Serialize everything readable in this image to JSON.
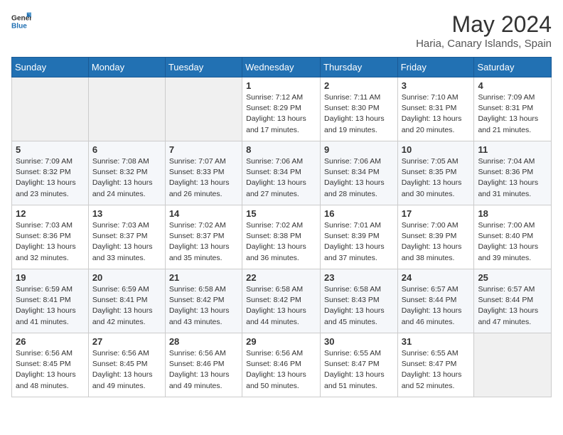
{
  "logo": {
    "text_general": "General",
    "text_blue": "Blue"
  },
  "header": {
    "title": "May 2024",
    "subtitle": "Haria, Canary Islands, Spain"
  },
  "weekdays": [
    "Sunday",
    "Monday",
    "Tuesday",
    "Wednesday",
    "Thursday",
    "Friday",
    "Saturday"
  ],
  "weeks": [
    [
      null,
      null,
      null,
      {
        "day": 1,
        "sunrise": "7:12 AM",
        "sunset": "8:29 PM",
        "daylight": "13 hours and 17 minutes."
      },
      {
        "day": 2,
        "sunrise": "7:11 AM",
        "sunset": "8:30 PM",
        "daylight": "13 hours and 19 minutes."
      },
      {
        "day": 3,
        "sunrise": "7:10 AM",
        "sunset": "8:31 PM",
        "daylight": "13 hours and 20 minutes."
      },
      {
        "day": 4,
        "sunrise": "7:09 AM",
        "sunset": "8:31 PM",
        "daylight": "13 hours and 21 minutes."
      }
    ],
    [
      {
        "day": 5,
        "sunrise": "7:09 AM",
        "sunset": "8:32 PM",
        "daylight": "13 hours and 23 minutes."
      },
      {
        "day": 6,
        "sunrise": "7:08 AM",
        "sunset": "8:32 PM",
        "daylight": "13 hours and 24 minutes."
      },
      {
        "day": 7,
        "sunrise": "7:07 AM",
        "sunset": "8:33 PM",
        "daylight": "13 hours and 26 minutes."
      },
      {
        "day": 8,
        "sunrise": "7:06 AM",
        "sunset": "8:34 PM",
        "daylight": "13 hours and 27 minutes."
      },
      {
        "day": 9,
        "sunrise": "7:06 AM",
        "sunset": "8:34 PM",
        "daylight": "13 hours and 28 minutes."
      },
      {
        "day": 10,
        "sunrise": "7:05 AM",
        "sunset": "8:35 PM",
        "daylight": "13 hours and 30 minutes."
      },
      {
        "day": 11,
        "sunrise": "7:04 AM",
        "sunset": "8:36 PM",
        "daylight": "13 hours and 31 minutes."
      }
    ],
    [
      {
        "day": 12,
        "sunrise": "7:03 AM",
        "sunset": "8:36 PM",
        "daylight": "13 hours and 32 minutes."
      },
      {
        "day": 13,
        "sunrise": "7:03 AM",
        "sunset": "8:37 PM",
        "daylight": "13 hours and 33 minutes."
      },
      {
        "day": 14,
        "sunrise": "7:02 AM",
        "sunset": "8:37 PM",
        "daylight": "13 hours and 35 minutes."
      },
      {
        "day": 15,
        "sunrise": "7:02 AM",
        "sunset": "8:38 PM",
        "daylight": "13 hours and 36 minutes."
      },
      {
        "day": 16,
        "sunrise": "7:01 AM",
        "sunset": "8:39 PM",
        "daylight": "13 hours and 37 minutes."
      },
      {
        "day": 17,
        "sunrise": "7:00 AM",
        "sunset": "8:39 PM",
        "daylight": "13 hours and 38 minutes."
      },
      {
        "day": 18,
        "sunrise": "7:00 AM",
        "sunset": "8:40 PM",
        "daylight": "13 hours and 39 minutes."
      }
    ],
    [
      {
        "day": 19,
        "sunrise": "6:59 AM",
        "sunset": "8:41 PM",
        "daylight": "13 hours and 41 minutes."
      },
      {
        "day": 20,
        "sunrise": "6:59 AM",
        "sunset": "8:41 PM",
        "daylight": "13 hours and 42 minutes."
      },
      {
        "day": 21,
        "sunrise": "6:58 AM",
        "sunset": "8:42 PM",
        "daylight": "13 hours and 43 minutes."
      },
      {
        "day": 22,
        "sunrise": "6:58 AM",
        "sunset": "8:42 PM",
        "daylight": "13 hours and 44 minutes."
      },
      {
        "day": 23,
        "sunrise": "6:58 AM",
        "sunset": "8:43 PM",
        "daylight": "13 hours and 45 minutes."
      },
      {
        "day": 24,
        "sunrise": "6:57 AM",
        "sunset": "8:44 PM",
        "daylight": "13 hours and 46 minutes."
      },
      {
        "day": 25,
        "sunrise": "6:57 AM",
        "sunset": "8:44 PM",
        "daylight": "13 hours and 47 minutes."
      }
    ],
    [
      {
        "day": 26,
        "sunrise": "6:56 AM",
        "sunset": "8:45 PM",
        "daylight": "13 hours and 48 minutes."
      },
      {
        "day": 27,
        "sunrise": "6:56 AM",
        "sunset": "8:45 PM",
        "daylight": "13 hours and 49 minutes."
      },
      {
        "day": 28,
        "sunrise": "6:56 AM",
        "sunset": "8:46 PM",
        "daylight": "13 hours and 49 minutes."
      },
      {
        "day": 29,
        "sunrise": "6:56 AM",
        "sunset": "8:46 PM",
        "daylight": "13 hours and 50 minutes."
      },
      {
        "day": 30,
        "sunrise": "6:55 AM",
        "sunset": "8:47 PM",
        "daylight": "13 hours and 51 minutes."
      },
      {
        "day": 31,
        "sunrise": "6:55 AM",
        "sunset": "8:47 PM",
        "daylight": "13 hours and 52 minutes."
      },
      null
    ]
  ],
  "labels": {
    "sunrise": "Sunrise:",
    "sunset": "Sunset:",
    "daylight": "Daylight:"
  }
}
